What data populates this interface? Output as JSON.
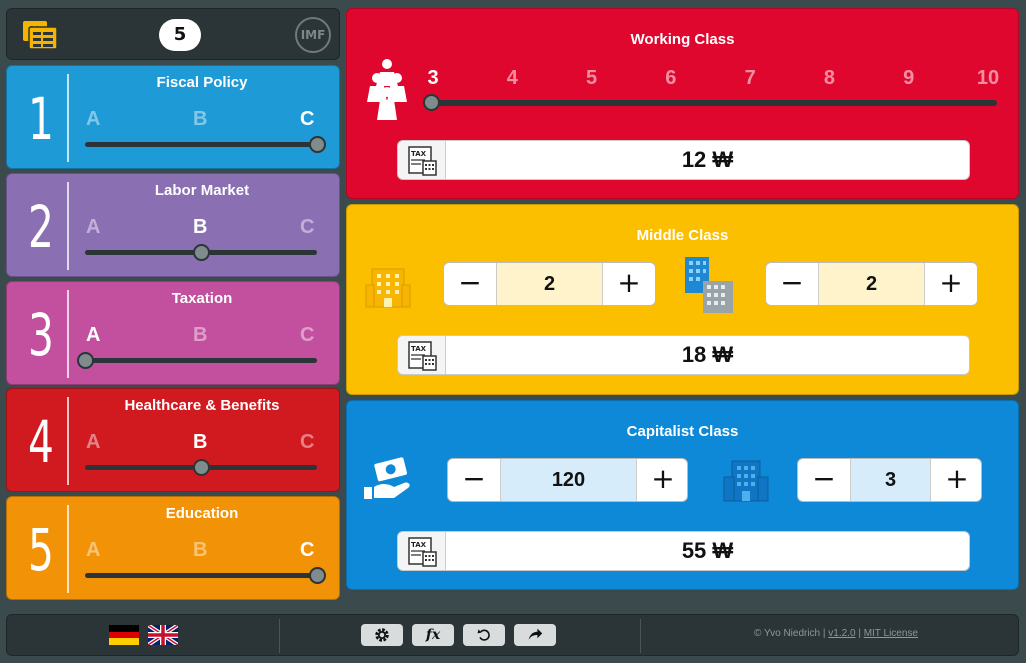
{
  "header": {
    "round": "5",
    "imf_label": "IMF",
    "budget_icon": "budget-sheet-icon"
  },
  "policies": [
    {
      "number": "1",
      "title": "Fiscal Policy",
      "options": [
        "A",
        "B",
        "C"
      ],
      "selected": "C",
      "color": "#1e9ad6"
    },
    {
      "number": "2",
      "title": "Labor Market",
      "options": [
        "A",
        "B",
        "C"
      ],
      "selected": "B",
      "color": "#8a6fb3"
    },
    {
      "number": "3",
      "title": "Taxation",
      "options": [
        "A",
        "B",
        "C"
      ],
      "selected": "A",
      "color": "#c2509f"
    },
    {
      "number": "4",
      "title": "Healthcare & Benefits",
      "options": [
        "A",
        "B",
        "C"
      ],
      "selected": "B",
      "color": "#d01a1f"
    },
    {
      "number": "5",
      "title": "Education",
      "options": [
        "A",
        "B",
        "C"
      ],
      "selected": "C",
      "color": "#f29307"
    }
  ],
  "working_class": {
    "title": "Working Class",
    "scale": [
      "3",
      "4",
      "5",
      "6",
      "7",
      "8",
      "9",
      "10"
    ],
    "selected": "3",
    "tax": "12 ₩",
    "color": "#e0072f",
    "icon": "workers-icon"
  },
  "middle_class": {
    "title": "Middle Class",
    "stepper1": {
      "minus": "−",
      "value": "2",
      "plus": "+"
    },
    "stepper2": {
      "minus": "−",
      "value": "2",
      "plus": "+"
    },
    "tax": "18 ₩",
    "color": "#fbbf00",
    "icons": [
      "office-building-icon",
      "city-buildings-icon"
    ]
  },
  "capitalist_class": {
    "title": "Capitalist Class",
    "stepper1": {
      "minus": "−",
      "value": "120",
      "plus": "+"
    },
    "stepper2": {
      "minus": "−",
      "value": "3",
      "plus": "+"
    },
    "tax": "55 ₩",
    "color": "#0d89d8",
    "icons": [
      "hand-money-icon",
      "corporate-building-icon"
    ]
  },
  "footer": {
    "languages": [
      "german-flag-icon",
      "uk-flag-icon"
    ],
    "tools": [
      "settings-icon",
      "formula-icon",
      "undo-icon",
      "share-icon"
    ],
    "formula_label": "fx",
    "credit_prefix": "© Yvo Niedrich |",
    "version": "v1.2.0",
    "pipe": "|",
    "license": "MIT License"
  }
}
